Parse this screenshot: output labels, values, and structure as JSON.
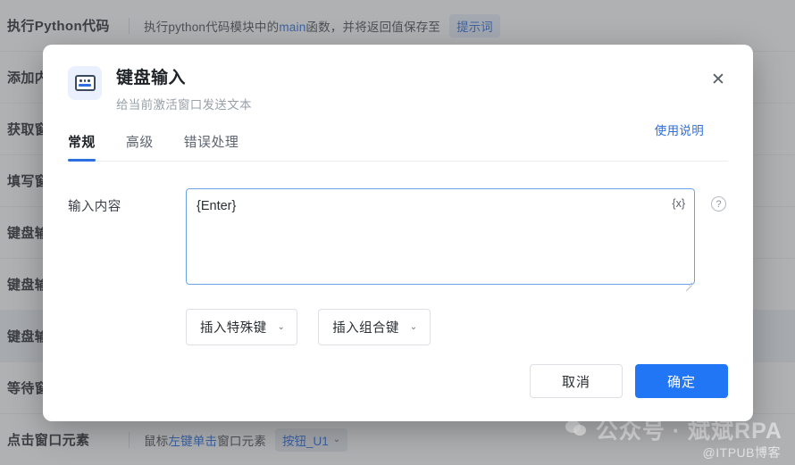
{
  "background": {
    "rows": [
      {
        "name": "执行Python代码",
        "desc_pre": "执行python代码模块中的",
        "desc_blue": "main",
        "desc_post": "函数，并将返回值保存至",
        "chip": "提示词",
        "chip_style": "blue",
        "chip_chevron": "",
        "selected": false
      },
      {
        "name": "添加内容",
        "desc_pre": "",
        "desc_blue": "",
        "desc_post": "",
        "chip": "",
        "chip_style": "",
        "chip_chevron": "",
        "selected": false
      },
      {
        "name": "获取窗口",
        "desc_pre": "",
        "desc_blue": "",
        "desc_post": "",
        "chip": "",
        "chip_style": "",
        "chip_chevron": "",
        "selected": false
      },
      {
        "name": "填写窗口",
        "desc_pre": "",
        "desc_blue": "",
        "desc_post": "",
        "chip": "",
        "chip_style": "",
        "chip_chevron": "",
        "selected": false
      },
      {
        "name": "键盘输入",
        "desc_pre": "",
        "desc_blue": "",
        "desc_post": "",
        "chip": "",
        "chip_style": "",
        "chip_chevron": "",
        "selected": false
      },
      {
        "name": "键盘输入",
        "desc_pre": "",
        "desc_blue": "",
        "desc_post": "",
        "chip": "",
        "chip_style": "",
        "chip_chevron": "",
        "selected": false
      },
      {
        "name": "键盘输入",
        "desc_pre": "",
        "desc_blue": "",
        "desc_post": "",
        "chip": "",
        "chip_style": "",
        "chip_chevron": "",
        "selected": true
      },
      {
        "name": "等待窗口",
        "desc_pre": "",
        "desc_blue": "",
        "desc_post": "",
        "chip": "",
        "chip_style": "",
        "chip_chevron": "",
        "selected": false
      },
      {
        "name": "点击窗口元素",
        "desc_pre": "鼠标",
        "desc_blue": "左键单击",
        "desc_post": "窗口元素",
        "chip": "按钮_U1",
        "chip_style": "gray",
        "chip_chevron": "⌄",
        "selected": false
      }
    ]
  },
  "watermark": {
    "main": "公众号 · 斌斌RPA",
    "sub": "@ITPUB博客",
    "icon": "wechat-icon"
  },
  "dialog": {
    "icon": "keyboard-icon",
    "title": "键盘输入",
    "subtitle": "给当前激活窗口发送文本",
    "help_link": "使用说明",
    "close_icon": "✕",
    "tabs": [
      {
        "label": "常规",
        "active": true
      },
      {
        "label": "高级",
        "active": false
      },
      {
        "label": "错误处理",
        "active": false
      }
    ],
    "field": {
      "label": "输入内容",
      "value": "{Enter}",
      "placeholder": "",
      "variable_icon": "{x}",
      "help_icon": "?"
    },
    "insert_buttons": [
      {
        "label": "插入特殊键",
        "chevron": "⌄"
      },
      {
        "label": "插入组合键",
        "chevron": "⌄"
      }
    ],
    "footer": {
      "cancel": "取消",
      "confirm": "确定"
    }
  },
  "colors": {
    "accent": "#2176f5",
    "link": "#2d6fe0",
    "focus_border": "#6ba3e8",
    "overlay": "rgba(80,82,86,0.45)"
  }
}
